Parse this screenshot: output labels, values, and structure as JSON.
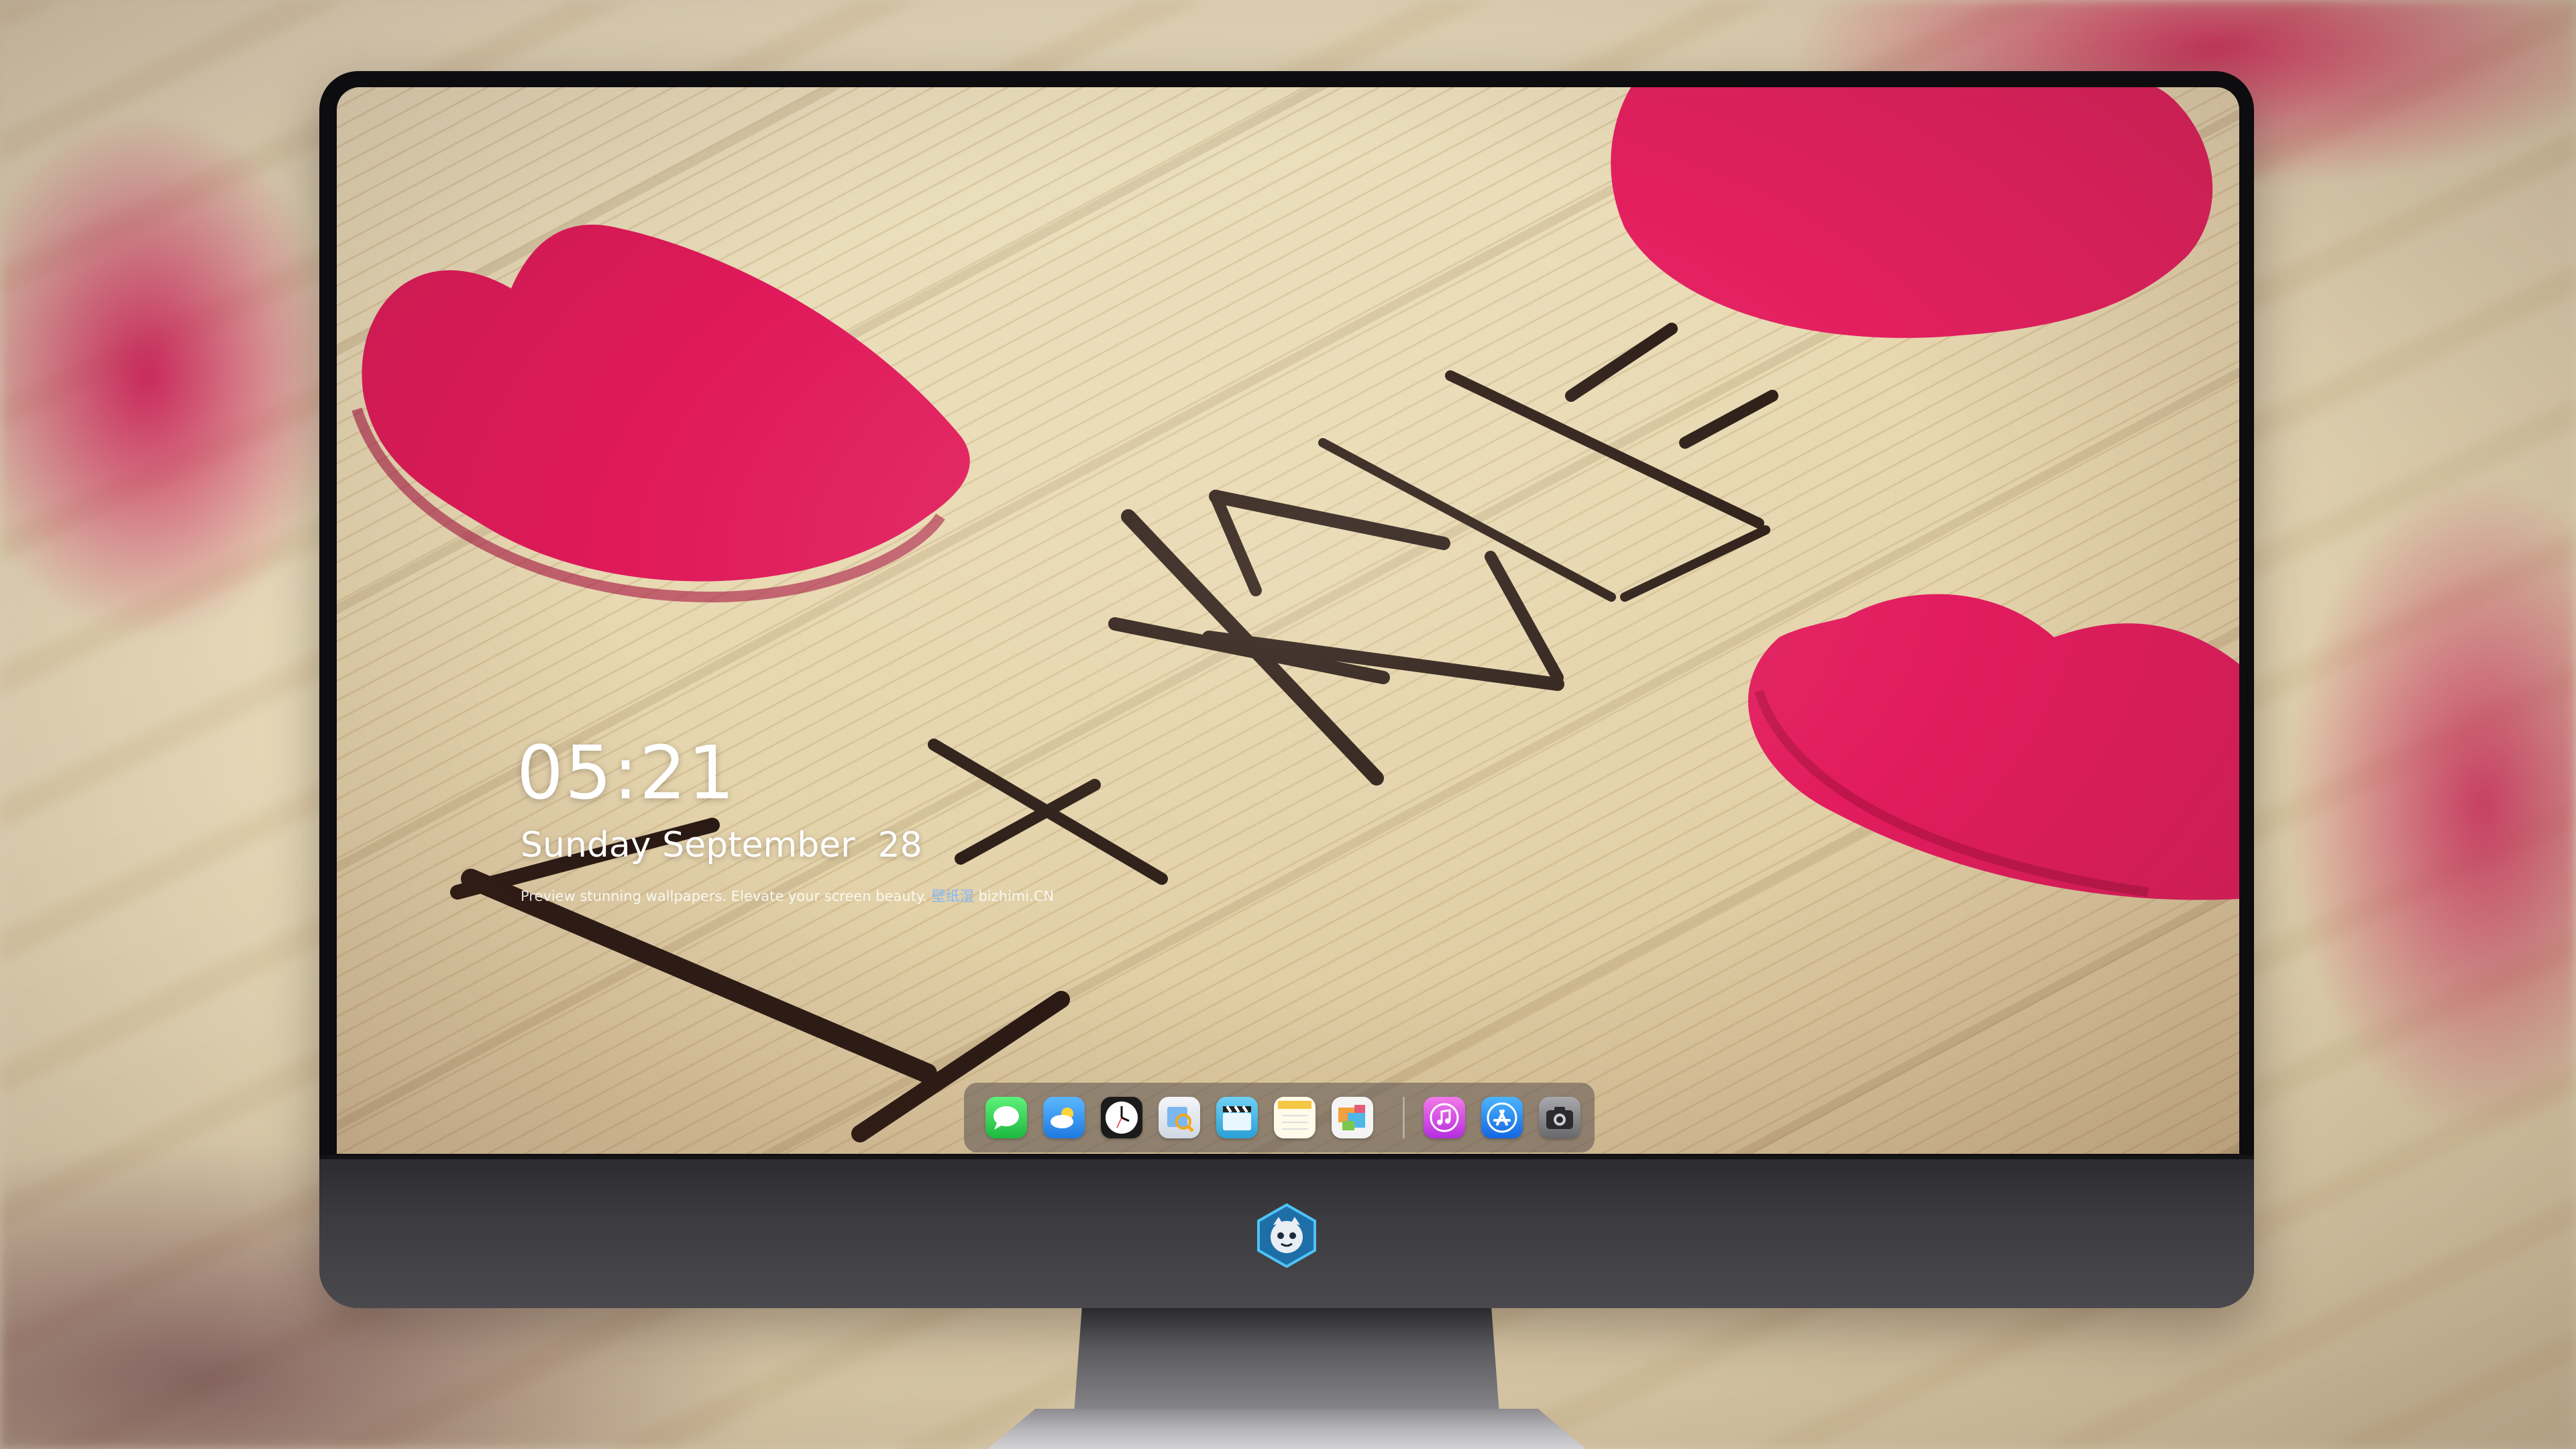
{
  "lockscreen": {
    "time": "05:21",
    "weekday": "Sunday",
    "month": "September",
    "day": "28",
    "tagline": "Preview stunning wallpapers. Elevate your screen beauty.",
    "brand_cn": "壁纸湿",
    "brand_en": "bizhimi.CN"
  },
  "dock": {
    "apps": [
      {
        "icon": "messages-icon",
        "color": "#2fcf4f"
      },
      {
        "icon": "weather-icon",
        "color": "#3a9cf2"
      },
      {
        "icon": "clock-icon",
        "color": "#1b1b1b"
      },
      {
        "icon": "preview-icon",
        "color": "#e9eef5"
      },
      {
        "icon": "clapper-icon",
        "color": "#3fb8e8"
      },
      {
        "icon": "notes-icon",
        "color": "#fff6d6"
      },
      {
        "icon": "photos-icon",
        "color": "#f2f2f2"
      },
      {
        "icon": "music-icon",
        "color": "#e04df0"
      },
      {
        "icon": "app-store-icon",
        "color": "#1d8df5"
      },
      {
        "icon": "camera-icon",
        "color": "#8a8a8e"
      }
    ]
  },
  "colors": {
    "heart": "#e0195a",
    "twig": "#2a1a14",
    "monitor_bezel": "#0d0d0f",
    "chin": "#3c3b40"
  }
}
